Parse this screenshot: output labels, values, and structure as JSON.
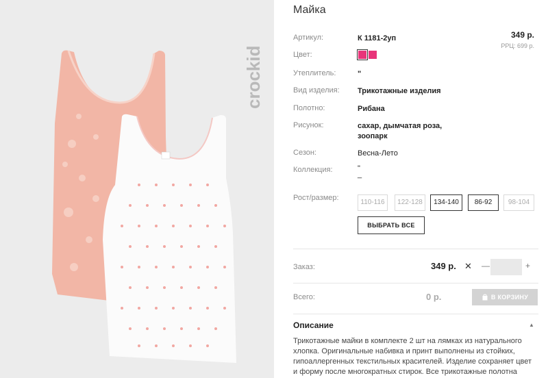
{
  "product": {
    "title": "Майка",
    "brand_logo": "crockid"
  },
  "pricing": {
    "price": "349 р.",
    "rrp": "РРЦ: 699 р."
  },
  "attributes": [
    {
      "label": "Артикул:",
      "value": "К 1181-2уп"
    },
    {
      "label": "Цвет:",
      "value": ""
    },
    {
      "label": "Утеплитель:",
      "value": "\""
    },
    {
      "label": "Вид изделия:",
      "value": "Трикотажные изделия"
    },
    {
      "label": "Полотно:",
      "value": "Рибана"
    },
    {
      "label": "Рисунок:",
      "value": "сахар, дымчатая роза, зоопарк"
    },
    {
      "label": "Сезон:",
      "value": "Весна-Лето"
    },
    {
      "label": "Коллекция:",
      "value": "\"\n_"
    }
  ],
  "colors": [
    "#e8357a",
    "#e8357a"
  ],
  "sizes": {
    "label": "Рост/размер:",
    "options": [
      {
        "label": "110-116",
        "active": false
      },
      {
        "label": "122-128",
        "active": false
      },
      {
        "label": "134-140",
        "active": true
      },
      {
        "label": "86-92",
        "active": true
      },
      {
        "label": "98-104",
        "active": false
      }
    ],
    "select_all": "ВЫБРАТЬ ВСЕ"
  },
  "order": {
    "label": "Заказ:",
    "price": "349 р.",
    "times": "✕",
    "minus": "—",
    "plus": "+",
    "quantity": ""
  },
  "total": {
    "label": "Всего:",
    "value": "0 р.",
    "cart_button": "В КОРЗИНУ"
  },
  "description": {
    "title": "Описание",
    "caret": "▲",
    "text": "Трикотажные майки в комплекте 2 шт на лямках из натурального хлопка. Оригинальные набивка и принт выполнены из стойких, гипоаллергенных текстильных красителей. Изделие сохраняет цвет и форму после многократных стирок. Все трикотажные полотна"
  }
}
